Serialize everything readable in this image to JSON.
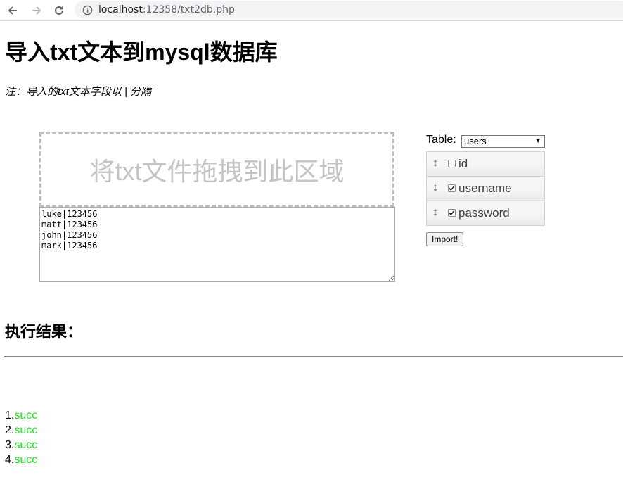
{
  "browser": {
    "url_host": "localhost",
    "url_rest": ":12358/txt2db.php"
  },
  "page": {
    "title": "导入txt文本到mysql数据库",
    "note": "注：导入的txt文本字段以 | 分隔",
    "drop_zone_text": "将txt文件拖拽到此区域",
    "textarea_value": "luke|123456\nmatt|123456\njohn|123456\nmark|123456",
    "table_label": "Table:",
    "table_selected": "users",
    "fields": [
      {
        "name": "id",
        "checked": false
      },
      {
        "name": "username",
        "checked": true
      },
      {
        "name": "password",
        "checked": true
      }
    ],
    "import_label": "Import!",
    "result_title": "执行结果：",
    "results": [
      {
        "index": "1.",
        "status": "succ"
      },
      {
        "index": "2.",
        "status": "succ"
      },
      {
        "index": "3.",
        "status": "succ"
      },
      {
        "index": "4.",
        "status": "succ"
      }
    ]
  },
  "colors": {
    "success": "#22dd22",
    "drop_zone_text": "#c4c4c4"
  }
}
